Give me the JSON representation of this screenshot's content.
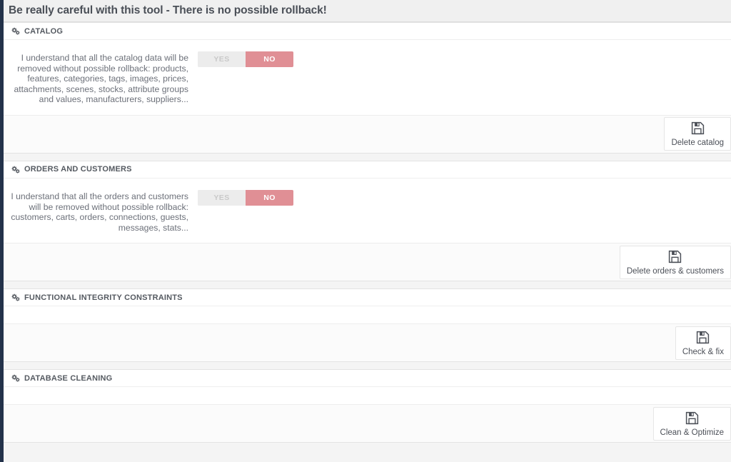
{
  "page": {
    "warning_title": "Be really careful with this tool - There is no possible rollback!"
  },
  "icons": {
    "section": "cogs-icon",
    "button": "floppy-disk-icon"
  },
  "colors": {
    "sidebar": "#23324a",
    "header_bar": "#f0f0f0",
    "switch_active": "#e08f95",
    "switch_inactive": "#ececec",
    "panel_bg": "#ffffff",
    "footer_bg": "#fbfbfb"
  },
  "switch": {
    "yes_label": "YES",
    "no_label": "NO",
    "selected": "NO"
  },
  "panels": [
    {
      "heading": "CATALOG",
      "consent_text": "I understand that all the catalog data will be removed without possible rollback: products, features, categories, tags, images, prices, attachments, scenes, stocks, attribute groups and values, manufacturers, suppliers...",
      "has_body": true,
      "button_label": "Delete catalog"
    },
    {
      "heading": "ORDERS AND CUSTOMERS",
      "consent_text": "I understand that all the orders and customers will be removed without possible rollback: customers, carts, orders, connections, guests, messages, stats...",
      "has_body": true,
      "button_label": "Delete orders & customers"
    },
    {
      "heading": "FUNCTIONAL INTEGRITY CONSTRAINTS",
      "consent_text": "",
      "has_body": false,
      "button_label": "Check & fix"
    },
    {
      "heading": "DATABASE CLEANING",
      "consent_text": "",
      "has_body": false,
      "button_label": "Clean & Optimize"
    }
  ]
}
